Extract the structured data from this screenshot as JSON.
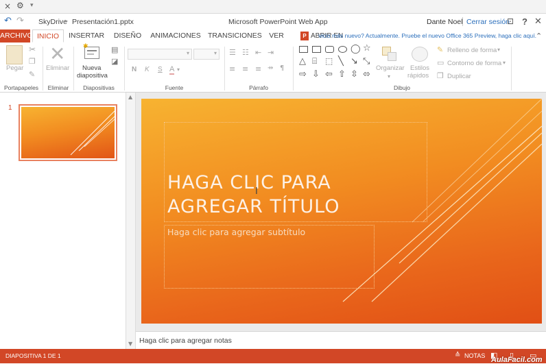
{
  "topstrip": {
    "close_glyph": "×",
    "menu_glyph": "▾"
  },
  "titlebar": {
    "breadcrumb_root": "SkyDrive",
    "breadcrumb_sep": "▸",
    "file_name": "Presentación1.pptx",
    "app_title": "Microsoft PowerPoint Web App",
    "user_name": "Dante Noel",
    "sign_out": "Cerrar sesión",
    "help": "?",
    "close": "✕"
  },
  "tabs": [
    {
      "label": "ARCHIVO"
    },
    {
      "label": "INICIO"
    },
    {
      "label": "INSERTAR"
    },
    {
      "label": "DISEÑO"
    },
    {
      "label": "ANIMACIONES"
    },
    {
      "label": "TRANSICIONES"
    },
    {
      "label": "VER"
    },
    {
      "label": "ABRIR EN POWERPOINT"
    }
  ],
  "notice": "¿Desea usar el servicio más nuevo? Actualmente. Pruebe el nuevo Office 365 Preview, haga clic aquí.",
  "ribbon": {
    "paste": "Pegar",
    "delete": "Eliminar",
    "new_slide_line1": "Nueva",
    "new_slide_line2": "diapositiva",
    "bold": "N",
    "italic": "K",
    "underline": "S",
    "font_color": "A",
    "organize": "Organizar",
    "styles_line1": "Estilos",
    "styles_line2": "rápidos",
    "fill": "Relleno de forma",
    "outline": "Contorno de forma",
    "duplicate": "Duplicar",
    "groups": {
      "clipboard": "Portapapeles",
      "delete": "Eliminar",
      "slides": "Diapositivas",
      "font": "Fuente",
      "paragraph": "Párrafo",
      "drawing": "Dibujo"
    }
  },
  "thumb": {
    "number": "1"
  },
  "slide": {
    "title_line1": "HAGA CLIC PARA",
    "title_line2": "AGREGAR TÍTULO",
    "subtitle": "Haga clic para agregar subtítulo"
  },
  "notes_placeholder": "Haga clic para agregar notas",
  "status": {
    "slide_counter": "DIAPOSITIVA 1 DE 1",
    "notes": "NOTAS",
    "watermark": "AulaFacil.com"
  },
  "colors": {
    "accent": "#d24726",
    "slide_top": "#f7b331",
    "slide_bottom": "#e14f15"
  }
}
